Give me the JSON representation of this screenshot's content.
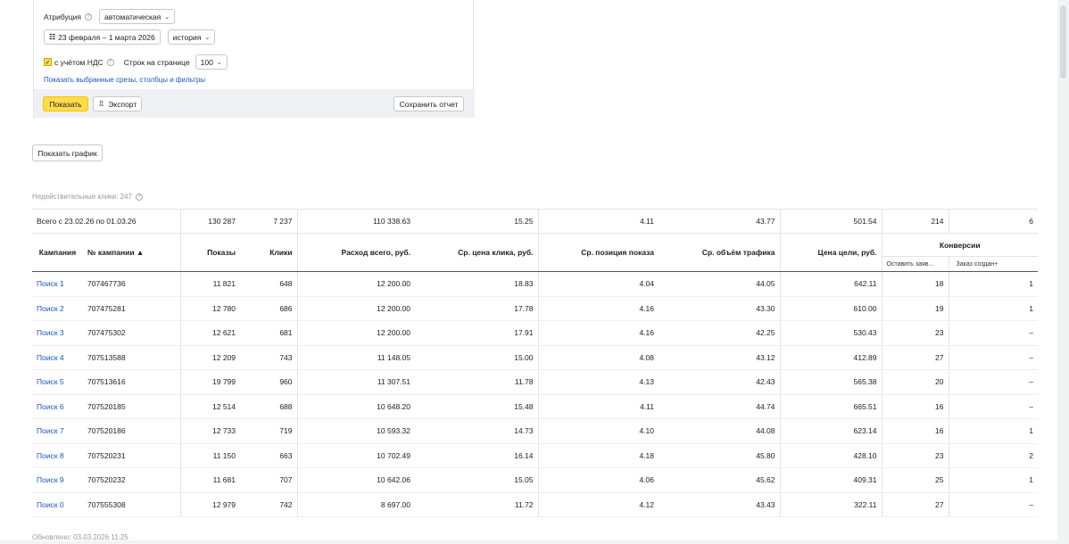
{
  "filters": {
    "attribution_label": "Атрибуция",
    "attribution_value": "автоматическая",
    "date_range": "23 февраля – 1 марта 2026",
    "history_value": "история",
    "vat_label": "с учётом НДС",
    "rows_label": "Строк на странице",
    "rows_value": "100",
    "show_slices_link": "Показать выбранные срезы, столбцы и фильтры",
    "show_button": "Показать",
    "export_button": "Экспорт",
    "save_report_button": "Сохранить отчет"
  },
  "show_chart_button": "Показать график",
  "invalid_clicks": "Недействительные клики: 247",
  "table": {
    "total": {
      "label": "Всего с 23.02.26 по 01.03.26",
      "impressions": "130 287",
      "clicks": "7 237",
      "cost": "110 338.63",
      "cpc": "15.25",
      "position": "4.11",
      "traffic": "43.77",
      "goal_price": "501.54",
      "conv1": "214",
      "conv2": "6"
    },
    "headers": {
      "campaign": "Кампания",
      "campaign_id": "№ кампании ▲",
      "impressions": "Показы",
      "clicks": "Клики",
      "cost": "Расход всего, руб.",
      "cpc": "Ср. цена клика, руб.",
      "position": "Ср. позиция показа",
      "traffic": "Ср. объём трафика",
      "goal_price": "Цена цели, руб.",
      "conversions": "Конверсии",
      "conv1": "Оставить заяв...",
      "conv2": "Заказ создан+"
    },
    "rows": [
      {
        "name": "Поиск 1",
        "id": "707467736",
        "impressions": "11 821",
        "clicks": "648",
        "cost": "12 200.00",
        "cpc": "18.83",
        "position": "4.04",
        "traffic": "44.05",
        "goal_price": "642.11",
        "conv1": "18",
        "conv2": "1"
      },
      {
        "name": "Поиск 2",
        "id": "707475281",
        "impressions": "12 780",
        "clicks": "686",
        "cost": "12 200.00",
        "cpc": "17.78",
        "position": "4.16",
        "traffic": "43.30",
        "goal_price": "610.00",
        "conv1": "19",
        "conv2": "1"
      },
      {
        "name": "Поиск 3",
        "id": "707475302",
        "impressions": "12 621",
        "clicks": "681",
        "cost": "12 200.00",
        "cpc": "17.91",
        "position": "4.16",
        "traffic": "42.25",
        "goal_price": "530.43",
        "conv1": "23",
        "conv2": "–"
      },
      {
        "name": "Поиск 4",
        "id": "707513588",
        "impressions": "12 209",
        "clicks": "743",
        "cost": "11 148.05",
        "cpc": "15.00",
        "position": "4.08",
        "traffic": "43.12",
        "goal_price": "412.89",
        "conv1": "27",
        "conv2": "–"
      },
      {
        "name": "Поиск 5",
        "id": "707513616",
        "impressions": "19 799",
        "clicks": "960",
        "cost": "11 307.51",
        "cpc": "11.78",
        "position": "4.13",
        "traffic": "42.43",
        "goal_price": "565.38",
        "conv1": "20",
        "conv2": "–"
      },
      {
        "name": "Поиск 6",
        "id": "707520185",
        "impressions": "12 514",
        "clicks": "688",
        "cost": "10 648.20",
        "cpc": "15.48",
        "position": "4.11",
        "traffic": "44.74",
        "goal_price": "665.51",
        "conv1": "16",
        "conv2": "–"
      },
      {
        "name": "Поиск 7",
        "id": "707520186",
        "impressions": "12 733",
        "clicks": "719",
        "cost": "10 593.32",
        "cpc": "14.73",
        "position": "4.10",
        "traffic": "44.08",
        "goal_price": "623.14",
        "conv1": "16",
        "conv2": "1"
      },
      {
        "name": "Поиск 8",
        "id": "707520231",
        "impressions": "11 150",
        "clicks": "663",
        "cost": "10 702.49",
        "cpc": "16.14",
        "position": "4.18",
        "traffic": "45.80",
        "goal_price": "428.10",
        "conv1": "23",
        "conv2": "2"
      },
      {
        "name": "Поиск 9",
        "id": "707520232",
        "impressions": "11 681",
        "clicks": "707",
        "cost": "10 642.06",
        "cpc": "15.05",
        "position": "4.06",
        "traffic": "45.62",
        "goal_price": "409.31",
        "conv1": "25",
        "conv2": "1"
      },
      {
        "name": "Поиск 0",
        "id": "707555308",
        "impressions": "12 979",
        "clicks": "742",
        "cost": "8 697.00",
        "cpc": "11.72",
        "position": "4.12",
        "traffic": "43.43",
        "goal_price": "322.11",
        "conv1": "27",
        "conv2": "–"
      }
    ]
  },
  "updated": "Обновлено: 03.03.2026 11:25",
  "colors": {
    "link": "#1a55c7",
    "accent_yellow": "#ffdb4d"
  },
  "icons": {
    "help": "help-circle-icon",
    "calendar": "calendar-icon",
    "export": "export-icon",
    "chevron": "chevron-down-icon",
    "check": "checkmark-icon"
  }
}
